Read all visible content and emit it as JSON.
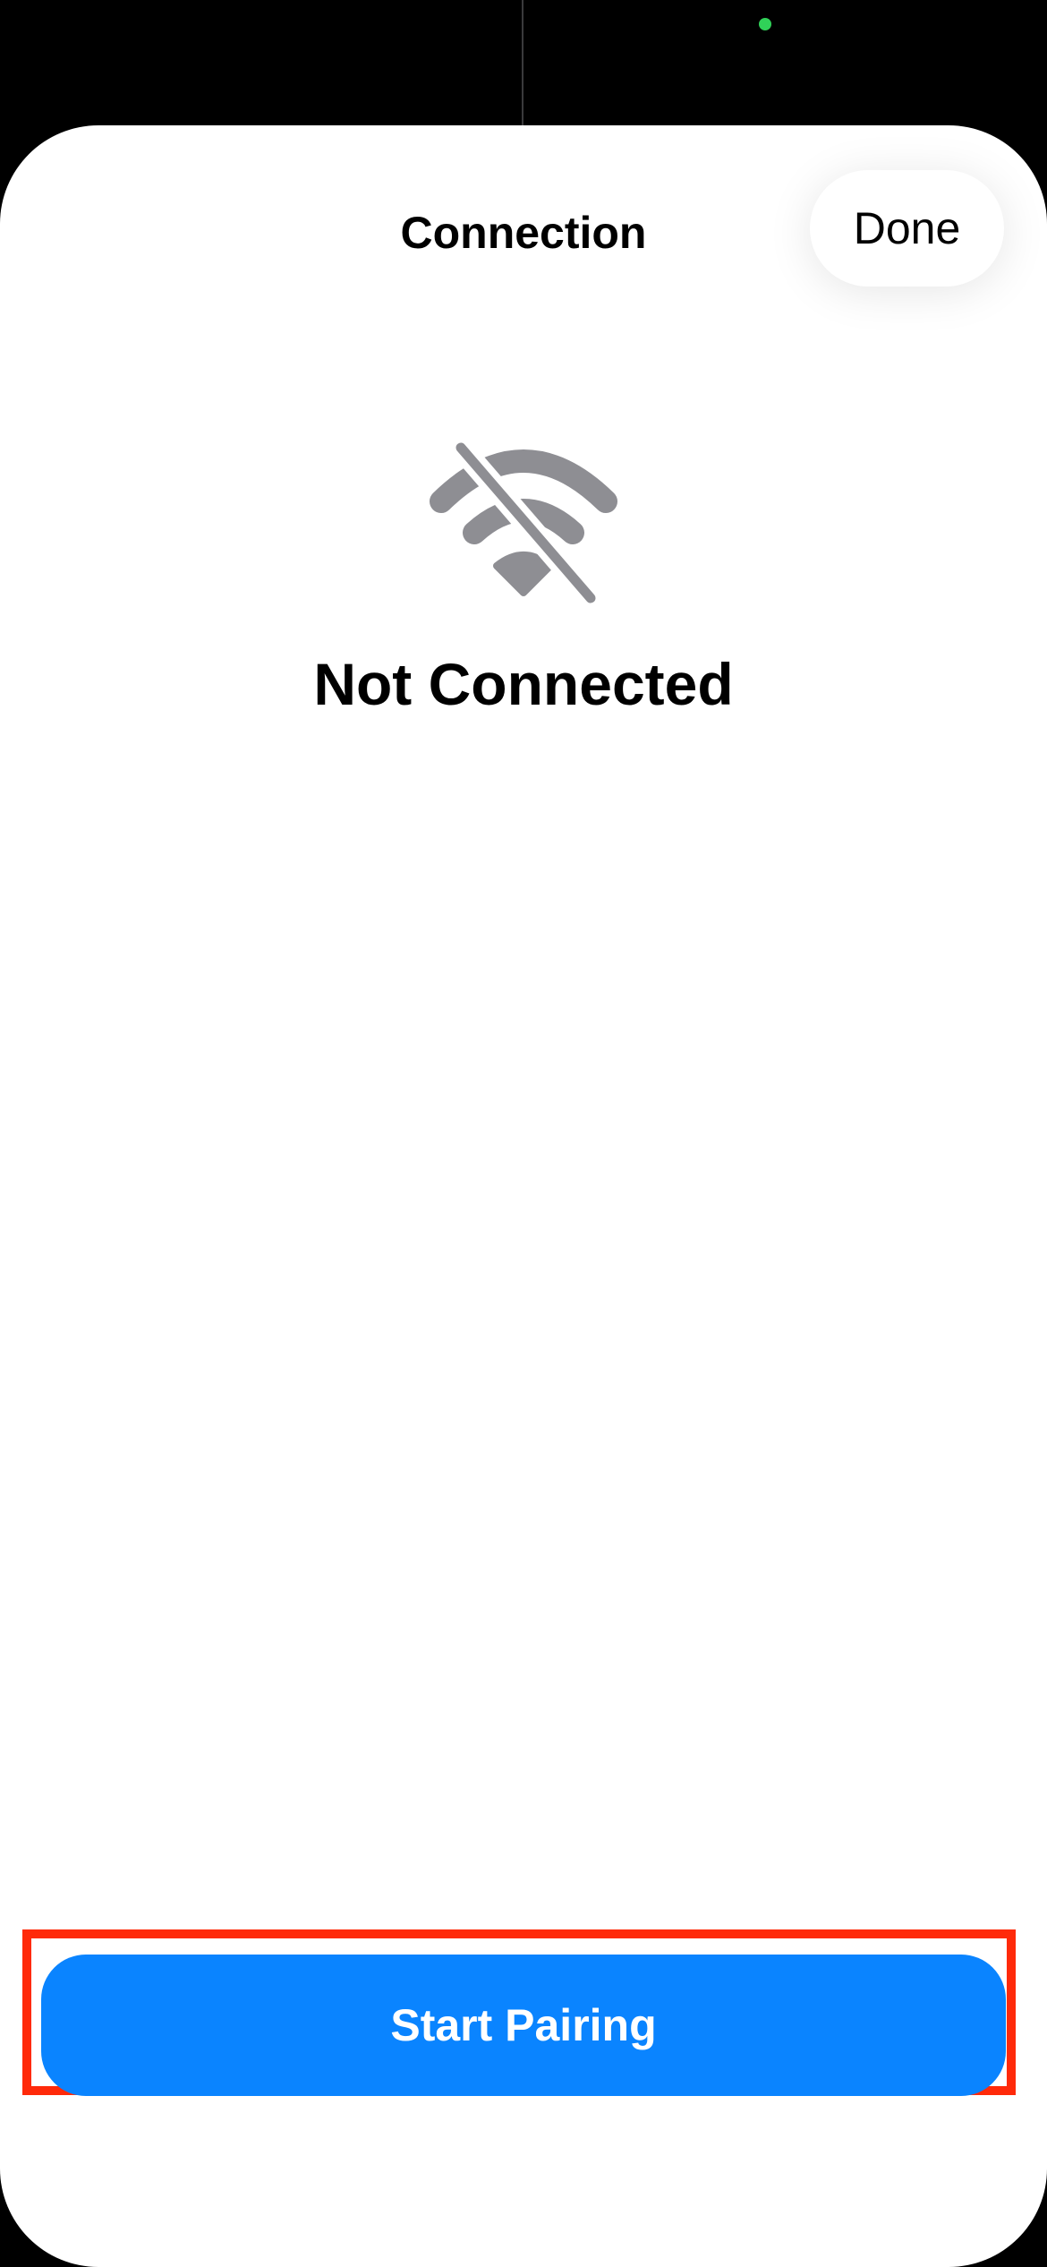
{
  "header": {
    "title": "Connection",
    "done_label": "Done"
  },
  "status": {
    "icon": "wifi-slash-icon",
    "title": "Not Connected"
  },
  "actions": {
    "primary_label": "Start Pairing"
  },
  "colors": {
    "accent": "#0a84ff",
    "icon_gray": "#8e8e93",
    "highlight": "#ff2a0a",
    "camera_indicator": "#30d158"
  }
}
